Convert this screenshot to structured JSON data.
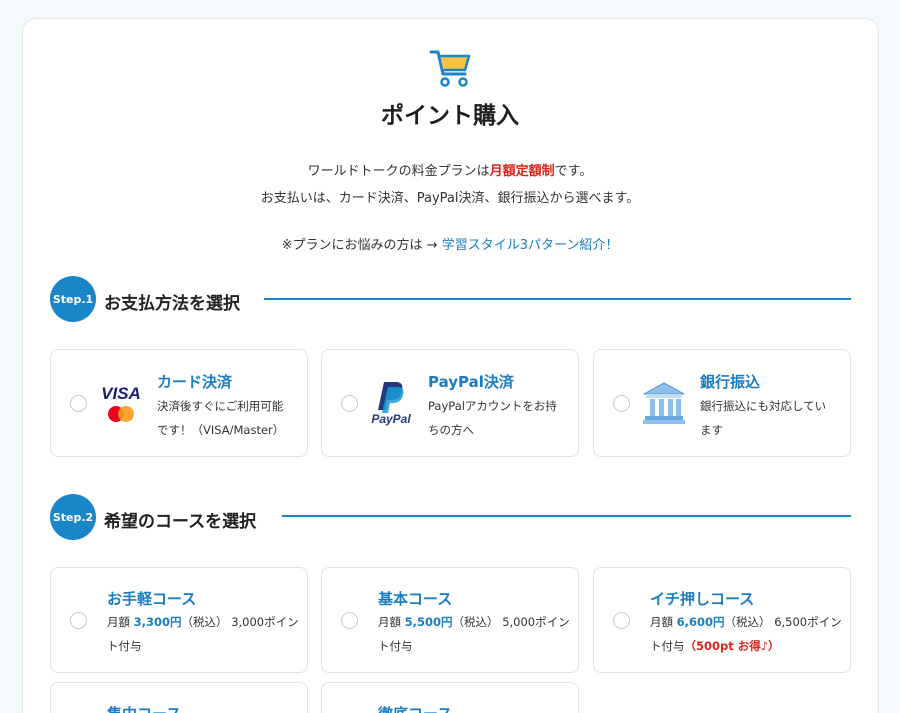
{
  "header": {
    "title": "ポイント購入",
    "intro_line1_prefix": "ワールドトークの料金プランは",
    "intro_line1_highlight": "月額定額制",
    "intro_line1_suffix": "です。",
    "intro_line2": "お支払いは、カード決済、PayPal決済、銀行振込から選べます。",
    "intro_line3_prefix": "※プランにお悩みの方は → ",
    "intro_line3_link": "学習スタイル3パターン紹介！"
  },
  "step1": {
    "badge": "Step.1",
    "title": "お支払方法を選択",
    "options": [
      {
        "title": "カード決済",
        "desc1": "決済後すぐにご利用可能",
        "desc2": "です！（VISA/Master）",
        "logo_text": "VISA"
      },
      {
        "title": "PayPal決済",
        "desc1": "PayPalアカウントをお持",
        "desc2": "ちの方へ",
        "logo_text": "PayPal"
      },
      {
        "title": "銀行振込",
        "desc1": "銀行振込にも対応してい",
        "desc2": "ます"
      }
    ]
  },
  "step2": {
    "badge": "Step.2",
    "title": "希望のコースを選択",
    "courses": [
      {
        "title": "お手軽コース",
        "prefix": "月額 ",
        "price": "3,300円",
        "tax": "（税込）",
        "points": " 3,000ポイン",
        "line2": "ト付与",
        "bonus": ""
      },
      {
        "title": "基本コース",
        "prefix": "月額 ",
        "price": "5,500円",
        "tax": "（税込）",
        "points": " 5,000ポイン",
        "line2": "ト付与",
        "bonus": ""
      },
      {
        "title": "イチ押しコース",
        "prefix": "月額 ",
        "price": "6,600円",
        "tax": "（税込）",
        "points": " 6,500ポイン",
        "line2": "ト付与",
        "bonus": "（500pt お得♪）"
      },
      {
        "title": "集中コース"
      },
      {
        "title": "徹底コース"
      }
    ]
  },
  "colors": {
    "accent": "#1a86c7",
    "link": "#1a7cc1",
    "highlight": "#e2231a"
  },
  "icons": {
    "cart": "shopping-cart-icon",
    "bank": "bank-icon"
  }
}
